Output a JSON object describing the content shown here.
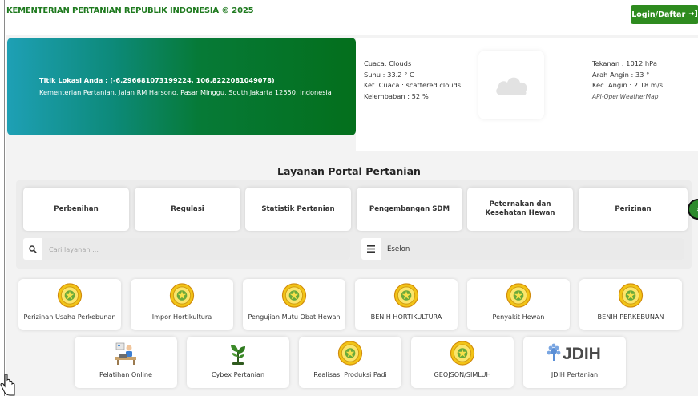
{
  "header": {
    "title": "KEMENTERIAN PERTANIAN REPUBLIK INDONESIA © 2025",
    "login_label": "Login/Daftar",
    "login_icon": "sign-in-icon"
  },
  "location": {
    "line1": "Titik Lokasi Anda : (-6.296681073199224, 106.8222081049078)",
    "line2": "Kementerian Pertanian, Jalan RM Harsono, Pasar Minggu, South Jakarta 12550, Indonesia"
  },
  "weather": {
    "cuaca": "Cuaca: Clouds",
    "suhu": "Suhu : 33.2 ° C",
    "ket_cuaca": "Ket. Cuaca : scattered clouds",
    "kelembaban": "Kelembaban : 52 %",
    "tekanan": "Tekanan : 1012 hPa",
    "arah_angin": "Arah Angin : 33 °",
    "kec_angin": "Kec. Angin : 2.18 m/s",
    "api_credit": "API-OpenWeatherMap",
    "icon": "cloud-icon"
  },
  "services": {
    "title": "Layanan Portal Pertanian",
    "tabs": [
      {
        "label": "Perbenihan"
      },
      {
        "label": "Regulasi"
      },
      {
        "label": "Statistik Pertanian"
      },
      {
        "label": "Pengembangan SDM"
      },
      {
        "label": "Peternakan dan Kesehatan Hewan"
      },
      {
        "label": "Perizinan"
      }
    ],
    "search": {
      "placeholder": "Cari layanan ..."
    },
    "filter": {
      "value": "Eselon"
    }
  },
  "cards": {
    "row1": [
      {
        "label": "Perizinan Usaha Perkebunan"
      },
      {
        "label": "Impor Hortikultura"
      },
      {
        "label": "Pengujian Mutu Obat Hewan"
      },
      {
        "label": "BENIH HORTIKULTURA"
      },
      {
        "label": "Penyakit Hewan"
      },
      {
        "label": "BENIH PERKEBUNAN"
      }
    ],
    "row2": [
      {
        "label": "Pelatihan Online"
      },
      {
        "label": "Cybex Pertanian"
      },
      {
        "label": "Realisasi Produksi Padi"
      },
      {
        "label": "GEOJSON/SIMLUH"
      },
      {
        "label": "JDIH Pertanian"
      }
    ],
    "jdih_logo_text": "JDIH"
  },
  "colors": {
    "brand_green": "#2e8b1f",
    "title_green": "#1f7a1f",
    "emblem_yellow": "#f2c416"
  }
}
